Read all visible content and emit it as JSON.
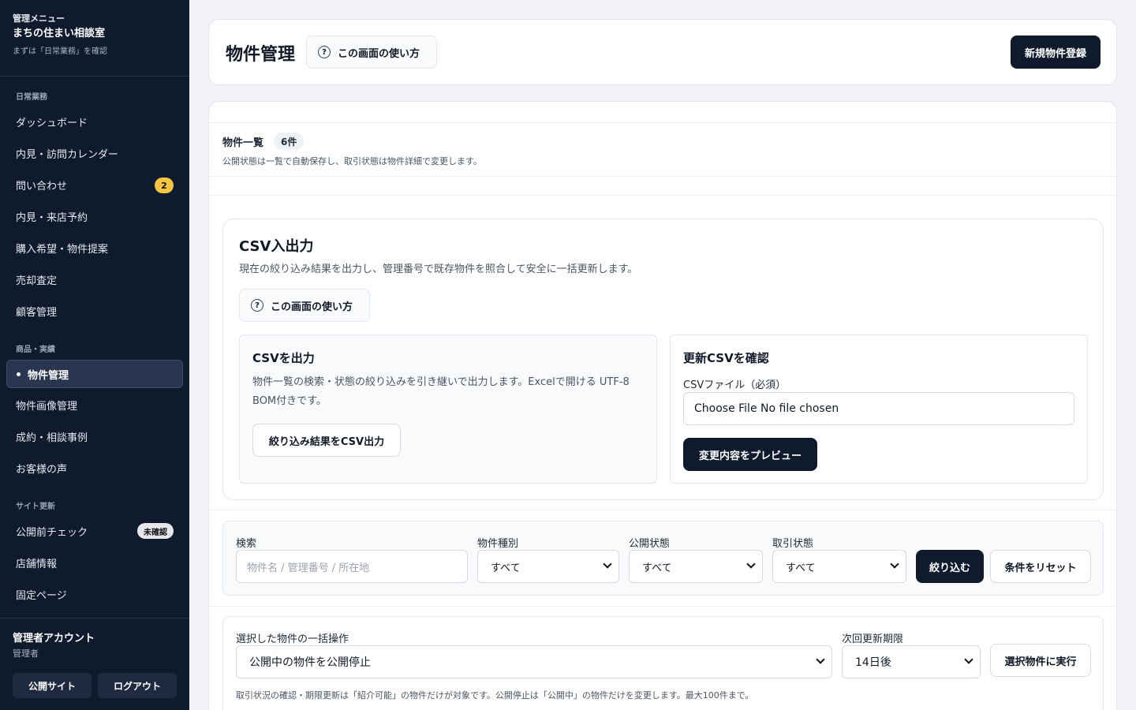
{
  "sidebar": {
    "kicker": "管理メニュー",
    "brand": "まちの住まい相談室",
    "sub": "まずは「日常業務」を確認",
    "sections": [
      "日常業務",
      "商品・実績",
      "サイト更新"
    ],
    "items": [
      {
        "label": "ダッシュボード"
      },
      {
        "label": "内見・訪問カレンダー"
      },
      {
        "label": "問い合わせ",
        "badge": "2"
      },
      {
        "label": "内見・来店予約"
      },
      {
        "label": "購入希望・物件提案"
      },
      {
        "label": "売却査定"
      },
      {
        "label": "顧客管理"
      },
      {
        "label": "物件管理"
      },
      {
        "label": "物件画像管理"
      },
      {
        "label": "成約・相談事例"
      },
      {
        "label": "お客様の声"
      },
      {
        "label": "公開前チェック",
        "badge": "未確認"
      },
      {
        "label": "店舗情報"
      },
      {
        "label": "固定ページ"
      }
    ],
    "account": "管理者アカウント",
    "role": "管理者",
    "public_site": "公開サイト",
    "logout": "ログアウト"
  },
  "header": {
    "title": "物件管理",
    "help": "この画面の使い方",
    "new_button": "新規物件登録"
  },
  "list": {
    "title": "物件一覧",
    "count": "6件",
    "desc": "公開状態は一覧で自動保存し、取引状態は物件詳細で変更します。"
  },
  "csv": {
    "title": "CSV入出力",
    "desc": "現在の絞り込み結果を出力し、管理番号で既存物件を照合して安全に一括更新します。",
    "help": "この画面の使い方",
    "export_title": "CSVを出力",
    "export_text": "物件一覧の検索・状態の絞り込みを引き継いで出力します。Excelで開ける UTF-8 BOM付きです。",
    "export_button": "絞り込み結果をCSV出力",
    "import_title": "更新CSVを確認",
    "file_label": "CSVファイル（必須）",
    "file_value": "Choose File No file chosen",
    "preview_button": "変更内容をプレビュー"
  },
  "filter": {
    "search_label": "検索",
    "search_placeholder": "物件名 / 管理番号 / 所在地",
    "type_label": "物件種別",
    "type_value": "すべて",
    "public_label": "公開状態",
    "public_value": "すべて",
    "trade_label": "取引状態",
    "trade_value": "すべて",
    "apply": "絞り込む",
    "reset": "条件をリセット"
  },
  "bulk": {
    "label": "選択した物件の一括操作",
    "value": "公開中の物件を公開停止",
    "deadline_label": "次回更新期限",
    "deadline_value": "14日後",
    "run": "選択物件に実行",
    "note": "取引状況の確認・期限更新は「紹介可能」の物件だけが対象です。公開停止は「公開中」の物件だけを変更します。最大100件まで。"
  }
}
